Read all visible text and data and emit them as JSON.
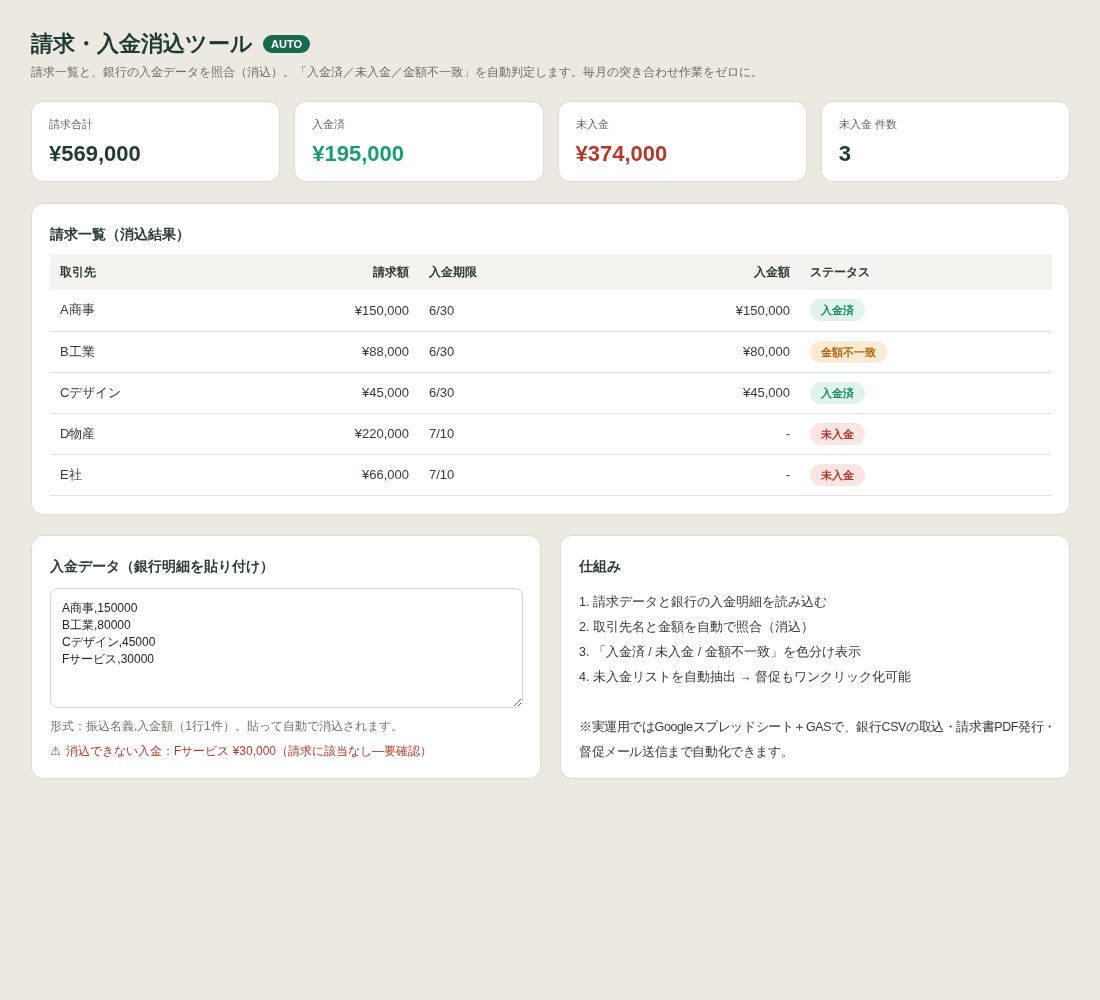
{
  "header": {
    "title": "請求・入金消込ツール",
    "badge": "AUTO",
    "subtitle": "請求一覧と、銀行の入金データを照合（消込）。「入金済／未入金／金額不一致」を自動判定します。毎月の突き合わせ作業をゼロに。"
  },
  "stats": [
    {
      "label": "請求合計",
      "value": "¥569,000",
      "color": "#1f3a33"
    },
    {
      "label": "入金済",
      "value": "¥195,000",
      "color": "#1e9a74"
    },
    {
      "label": "未入金",
      "value": "¥374,000",
      "color": "#b5392b"
    },
    {
      "label": "未入金 件数",
      "value": "3",
      "color": "#1f3a33"
    }
  ],
  "invoice_table": {
    "title": "請求一覧（消込結果）",
    "columns": [
      "取引先",
      "請求額",
      "入金期限",
      "入金額",
      "ステータス"
    ],
    "rows": [
      {
        "client": "A商事",
        "amount": "¥150,000",
        "due": "6/30",
        "paid": "¥150,000",
        "status": {
          "label": "入金済",
          "kind": "paid"
        }
      },
      {
        "client": "B工業",
        "amount": "¥88,000",
        "due": "6/30",
        "paid": "¥80,000",
        "status": {
          "label": "金額不一致",
          "kind": "mismatch"
        }
      },
      {
        "client": "Cデザイン",
        "amount": "¥45,000",
        "due": "6/30",
        "paid": "¥45,000",
        "status": {
          "label": "入金済",
          "kind": "paid"
        }
      },
      {
        "client": "D物産",
        "amount": "¥220,000",
        "due": "7/10",
        "paid": "-",
        "status": {
          "label": "未入金",
          "kind": "unpaid"
        }
      },
      {
        "client": "E社",
        "amount": "¥66,000",
        "due": "7/10",
        "paid": "-",
        "status": {
          "label": "未入金",
          "kind": "unpaid"
        }
      }
    ]
  },
  "payment_panel": {
    "title": "入金データ（銀行明細を貼り付け）",
    "value": "A商事,150000\nB工業,80000\nCデザイン,45000\nFサービス,30000",
    "hint": "形式：振込名義,入金額（1行1件）。貼って自動で消込されます。",
    "warning": {
      "icon": "⚠",
      "text": "消込できない入金：Fサービス ¥30,000（請求に該当なし—要確認）"
    }
  },
  "how_it_works": {
    "title": "仕組み",
    "steps": [
      "1. 請求データと銀行の入金明細を読み込む",
      "2. 取引先名と金額を自動で照合（消込）",
      "3. 「入金済 / 未入金 / 金額不一致」を色分け表示",
      "4. 未入金リストを自動抽出 → 督促もワンクリック化可能"
    ],
    "note": "※実運用ではGoogleスプレッドシート＋GASで、銀行CSVの取込・請求書PDF発行・督促メール送信まで自動化できます。"
  }
}
